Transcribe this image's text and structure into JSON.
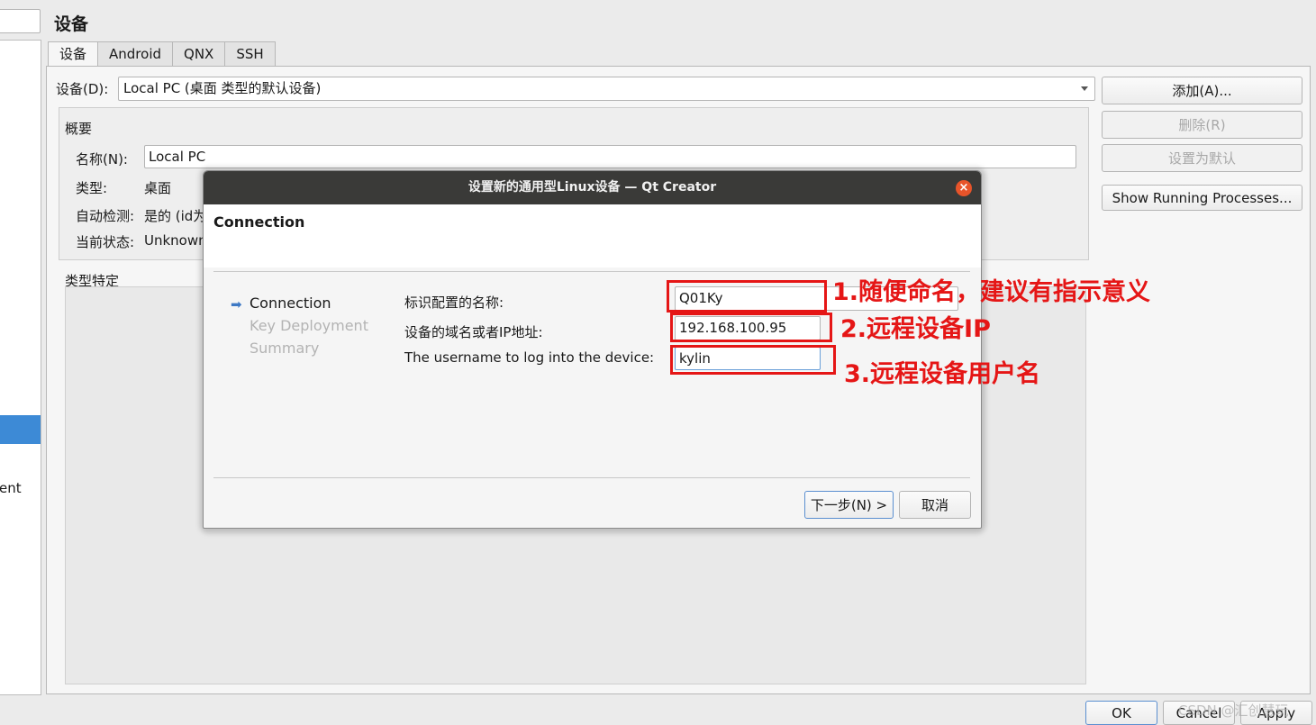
{
  "page": {
    "title": "设备",
    "left_list_partial_text": "ent"
  },
  "tabs": [
    "设备",
    "Android",
    "QNX",
    "SSH"
  ],
  "device": {
    "label": "设备(D):",
    "selected": "Local PC (桌面 类型的默认设备)"
  },
  "side_buttons": {
    "add": "添加(A)...",
    "remove": "删除(R)",
    "set_default": "设置为默认",
    "show_processes": "Show Running Processes..."
  },
  "summary": {
    "title": "概要",
    "name_label": "名称(N):",
    "name_value": "Local PC",
    "type_label": "类型:",
    "type_value": "桌面",
    "autodetect_label": "自动检测:",
    "autodetect_value": "是的 (id为",
    "state_label": "当前状态:",
    "state_value": "Unknown"
  },
  "type_specific": {
    "title": "类型特定"
  },
  "dialog": {
    "title": "设置新的通用型Linux设备 — Qt Creator",
    "close": "×",
    "heading": "Connection",
    "steps": [
      {
        "label": "Connection",
        "active": true
      },
      {
        "label": "Key Deployment",
        "active": false
      },
      {
        "label": "Summary",
        "active": false
      }
    ],
    "fields": {
      "name_label": "标识配置的名称:",
      "name_value": "Q01Ky",
      "host_label": "设备的域名或者IP地址:",
      "host_value": "192.168.100.95",
      "user_label": "The username to log into the device:",
      "user_value": "kylin"
    },
    "buttons": {
      "next": "下一步(N) >",
      "cancel": "取消"
    }
  },
  "annotations": {
    "a1": "1.随便命名，建议有指示意义",
    "a2": "2.远程设备IP",
    "a3": "3.远程设备用户名"
  },
  "footer": {
    "ok": "OK",
    "cancel": "Cancel",
    "apply": "Apply"
  },
  "watermark": "CSDN @汇创慧玩",
  "colors": {
    "annotation_red": "#e51616",
    "selection_blue": "#3d8ad6",
    "titlebar": "#3a3a38",
    "close_orange": "#e8542a"
  },
  "icons": {
    "step_arrow": "right-arrow-icon",
    "combo_arrow": "chevron-down-icon",
    "close": "close-icon"
  }
}
